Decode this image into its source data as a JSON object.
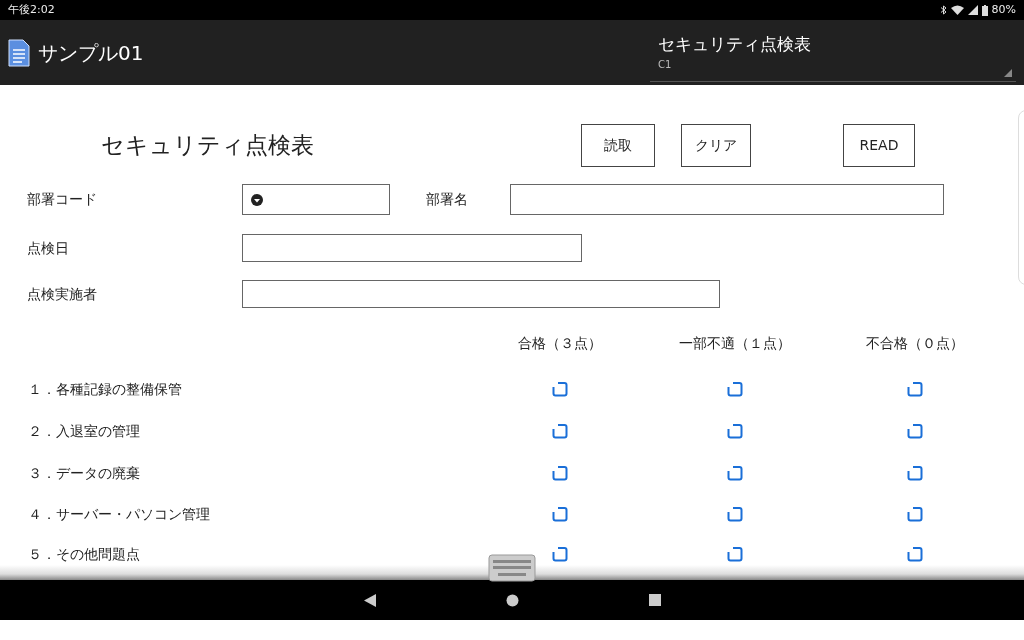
{
  "status_bar": {
    "time": "午後2:02",
    "battery": "80%"
  },
  "app_bar": {
    "title": "サンプル01",
    "sheet": {
      "title": "セキュリティ点検表",
      "subtitle": "C1"
    }
  },
  "form": {
    "title": "セキュリティ点検表",
    "buttons": [
      "読取",
      "クリア",
      "READ"
    ],
    "fields": [
      {
        "label": "部署コード",
        "kind": "dropdown"
      },
      {
        "label": "部署名",
        "kind": "text"
      },
      {
        "label": "点検日",
        "kind": "text"
      },
      {
        "label": "点検実施者",
        "kind": "text"
      }
    ],
    "columns": [
      "合格（３点）",
      "一部不適（１点）",
      "不合格（０点）"
    ],
    "items": [
      {
        "label": "１．各種記録の整備保管",
        "checks": [
          false,
          false,
          false
        ]
      },
      {
        "label": "２．入退室の管理",
        "checks": [
          false,
          false,
          false
        ]
      },
      {
        "label": "３．データの廃棄",
        "checks": [
          false,
          false,
          false
        ]
      },
      {
        "label": "４．サーバー・パソコン管理",
        "checks": [
          false,
          false,
          false
        ]
      },
      {
        "label": "５．その他問題点",
        "checks": [
          false,
          false,
          false
        ]
      }
    ]
  }
}
